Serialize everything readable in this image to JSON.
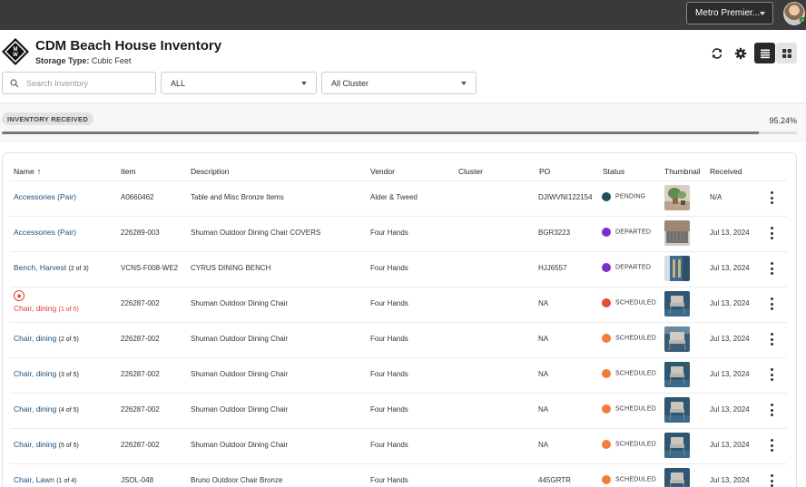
{
  "topbar": {
    "org_label": "Metro Premier..."
  },
  "header": {
    "title": "CDM Beach House Inventory",
    "storage_label": "Storage Type:",
    "storage_value": "Cubic Feet"
  },
  "filters": {
    "search_placeholder": "Search Inventory",
    "status_value": "ALL",
    "cluster_value": "All Cluster"
  },
  "progress": {
    "badge": "INVENTORY RECEIVED",
    "percent_label": "95.24%",
    "fraction": 0.9524
  },
  "table": {
    "columns": {
      "name": "Name",
      "item": "Item",
      "description": "Description",
      "vendor": "Vendor",
      "cluster": "Cluster",
      "po": "PO",
      "status": "Status",
      "thumbnail": "Thumbnail",
      "received": "Received"
    },
    "rows": [
      {
        "name": "Accessories (Pair)",
        "sub": "",
        "item": "A0660462",
        "description": "Table and Misc Bronze Items",
        "vendor": "Alder & Tweed",
        "cluster": "",
        "po": "DJIWVNI122154",
        "status": "PENDING",
        "status_color": "#1f4e5f",
        "received": "N/A",
        "thumb": "plant"
      },
      {
        "name": "Accessories (Pair)",
        "sub": "",
        "item": "226289-003",
        "description": "Shuman Outdoor Dining Chair COVERS",
        "vendor": "Four Hands",
        "cluster": "",
        "po": "BGR3223",
        "status": "DEPARTED",
        "status_color": "#7b2fc9",
        "received": "Jul 13, 2024",
        "thumb": "cover"
      },
      {
        "name": "Bench, Harvest",
        "sub": "(2 of 3)",
        "item": "VCNS-F008-WE2",
        "description": "CYRUS DINING BENCH",
        "vendor": "Four Hands",
        "cluster": "",
        "po": "HJJ6557",
        "status": "DEPARTED",
        "status_color": "#7b2fc9",
        "received": "Jul 13, 2024",
        "thumb": "bench"
      },
      {
        "name": "Chair, dining",
        "sub": "(1 of 5)",
        "item": "226287-002",
        "description": "Shuman Outdoor Dining Chair",
        "vendor": "Four Hands",
        "cluster": "",
        "po": "NA",
        "status": "SCHEDULED",
        "status_color": "#e04a3f",
        "received": "Jul 13, 2024",
        "thumb": "chair",
        "alert": true
      },
      {
        "name": "Chair, dining",
        "sub": "(2 of 5)",
        "item": "226287-002",
        "description": "Shuman Outdoor Dining Chair",
        "vendor": "Four Hands",
        "cluster": "",
        "po": "NA",
        "status": "SCHEDULED",
        "status_color": "#f07f35",
        "received": "Jul 13, 2024",
        "thumb": "chair2"
      },
      {
        "name": "Chair, dining",
        "sub": "(3 of 5)",
        "item": "226287-002",
        "description": "Shuman Outdoor Dining Chair",
        "vendor": "Four Hands",
        "cluster": "",
        "po": "NA",
        "status": "SCHEDULED",
        "status_color": "#f07f35",
        "received": "Jul 13, 2024",
        "thumb": "chair"
      },
      {
        "name": "Chair, dining",
        "sub": "(4 of 5)",
        "item": "226287-002",
        "description": "Shuman Outdoor Dining Chair",
        "vendor": "Four Hands",
        "cluster": "",
        "po": "NA",
        "status": "SCHEDULED",
        "status_color": "#f07f35",
        "received": "Jul 13, 2024",
        "thumb": "chair"
      },
      {
        "name": "Chair, dining",
        "sub": "(5 of 5)",
        "item": "226287-002",
        "description": "Shuman Outdoor Dining Chair",
        "vendor": "Four Hands",
        "cluster": "",
        "po": "NA",
        "status": "SCHEDULED",
        "status_color": "#f07f35",
        "received": "Jul 13, 2024",
        "thumb": "chair"
      },
      {
        "name": "Chair, Lawn",
        "sub": "(1 of 4)",
        "item": "JSOL-048",
        "description": "Bruno Outdoor Chair Bronze",
        "vendor": "Four Hands",
        "cluster": "",
        "po": "445GRTR",
        "status": "SCHEDULED",
        "status_color": "#f07f35",
        "received": "Jul 13, 2024",
        "thumb": "chair"
      }
    ]
  }
}
